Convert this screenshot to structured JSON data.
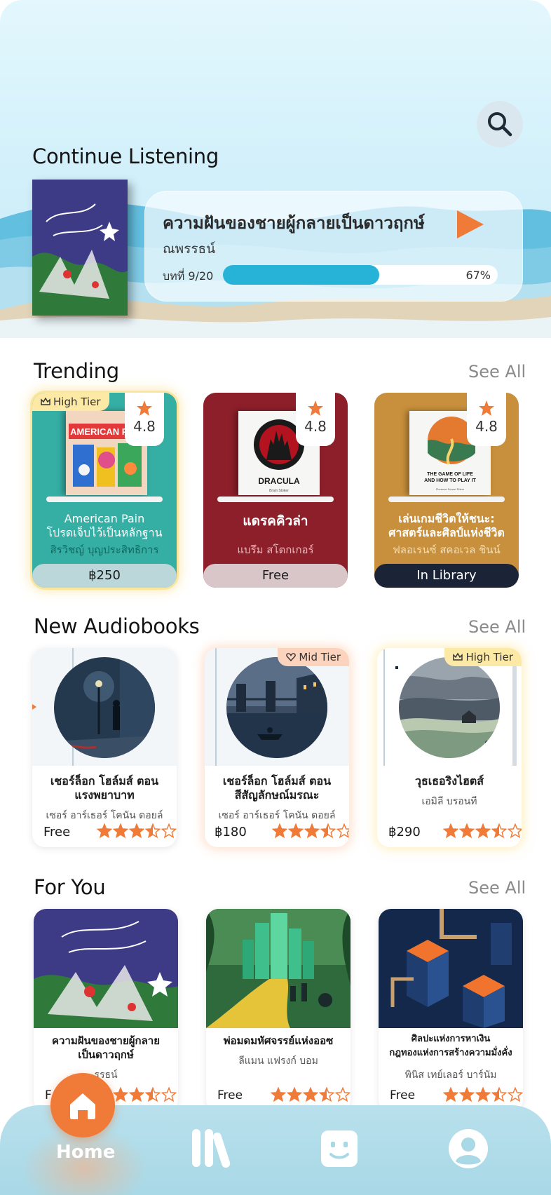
{
  "continue_listening": {
    "heading": "Continue Listening",
    "book_title": "ความฝันของชายผู้กลายเป็นดาวฤกษ์",
    "author": "ณพรรธน์",
    "chapter": "บทที่ 9/20",
    "progress_percent": 67,
    "progress_label": "67%"
  },
  "trending": {
    "heading": "Trending",
    "see_all": "See All",
    "items": [
      {
        "tier": "High Tier",
        "rating": "4.8",
        "title_line1": "American Pain",
        "title_line2": "โปรดเจ็บไว้เป็นหลักฐาน",
        "author": "สิรวิชญ์ บุญประสิทธิการ",
        "price": "฿250",
        "bg": "#35aea4"
      },
      {
        "rating": "4.8",
        "title_line1": "แดรคคิวล่า",
        "title_line2": "",
        "author": "แบรึม สโตกเกอร์",
        "price": "Free",
        "bg": "#8c1f2a"
      },
      {
        "rating": "4.8",
        "title_line1": "เล่นเกมชีวิตให้ชนะ:",
        "title_line2": "ศาสตร์และศิลป์แห่งชีวิต",
        "author": "ฟลอเรนซ์ สคอเวล ชินน์",
        "price": "In Library",
        "bg": "#c8903c"
      }
    ],
    "cover_texts": {
      "american": "AMERICAN PAIN",
      "dracula": "DRACULA",
      "dracula_sub": "Bram Stoker",
      "game_line1": "THE GAME OF LIFE",
      "game_line2": "AND HOW TO PLAY IT",
      "game_author": "Florence Scovel Shinn"
    }
  },
  "new_audiobooks": {
    "heading": "New Audiobooks",
    "see_all": "See All",
    "items": [
      {
        "title_line1": "เชอร์ล็อก โฮล์มส์ ตอน",
        "title_line2": "แรงพยาบาท",
        "author": "เซอร์ อาร์เธอร์ โคนัน ดอยล์",
        "price": "Free",
        "rating": 3.5
      },
      {
        "tier": "Mid Tier",
        "title_line1": "เชอร์ล็อก โฮล์มส์ ตอน",
        "title_line2": "สีสัญลักษณ์มรณะ",
        "author": "เซอร์ อาร์เธอร์ โคนัน ดอยล์",
        "price": "฿180",
        "rating": 3.5
      },
      {
        "tier": "High Tier",
        "title_line1": "วุธเธอริงไฮตส์",
        "title_line2": "",
        "author": "เอมิลี บรอนที",
        "price": "฿290",
        "rating": 3.5
      }
    ]
  },
  "for_you": {
    "heading": "For You",
    "see_all": "See All",
    "items": [
      {
        "title_line1": "ความฝันของชายผู้กลาย",
        "title_line2": "เป็นดาวฤกษ์",
        "author": "ณพรรธน์",
        "author_visible": "รรธน์",
        "price": "F",
        "rating": 3.5
      },
      {
        "title_line1": "พ่อมดมหัศจรรย์แห่งออซ",
        "title_line2": "",
        "author": "ลีแมน แฟรงก์ บอม",
        "price": "Free",
        "rating": 3.5
      },
      {
        "title_line1": "ศิลปะแห่งการหาเงิน",
        "title_line2": "กฎทองแห่งการสร้างความมั่งคั่ง",
        "author": "พินิส เทย์เลอร์ บาร์นัม",
        "price": "Free",
        "rating": 3.5
      }
    ]
  },
  "bottom_nav": {
    "home_label": "Home",
    "items": [
      "home-icon",
      "library-icon",
      "chat-face-icon",
      "profile-icon"
    ]
  },
  "colors": {
    "accent": "#f07a38",
    "progress": "#27b3d8",
    "star": "#f07a38",
    "nav_bg": "#b0dce9"
  }
}
